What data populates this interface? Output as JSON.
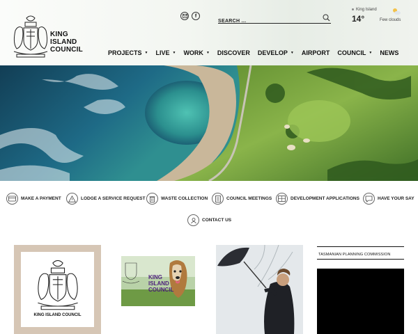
{
  "site": {
    "brand_lines": [
      "KING",
      "ISLAND",
      "COUNCIL"
    ]
  },
  "header": {
    "social": [
      {
        "icon": "email-icon"
      },
      {
        "icon": "facebook-icon",
        "glyph": "f"
      }
    ],
    "search": {
      "placeholder": "SEARCH ..."
    },
    "weather": {
      "location": "King Island",
      "temperature": "14°",
      "description": "Few clouds",
      "icon": "few-clouds-icon"
    }
  },
  "nav": {
    "items": [
      {
        "label": "PROJECTS",
        "dropdown": true
      },
      {
        "label": "LIVE",
        "dropdown": true
      },
      {
        "label": "WORK",
        "dropdown": true
      },
      {
        "label": "DISCOVER",
        "dropdown": false
      },
      {
        "label": "DEVELOP",
        "dropdown": true
      },
      {
        "label": "AIRPORT",
        "dropdown": false
      },
      {
        "label": "COUNCIL",
        "dropdown": true
      },
      {
        "label": "NEWS",
        "dropdown": false
      }
    ]
  },
  "quick_links": [
    {
      "label": "MAKE A PAYMENT",
      "icon": "payment-icon"
    },
    {
      "label": "LODGE A SERVICE REQUEST",
      "icon": "warning-icon"
    },
    {
      "label": "WASTE COLLECTION",
      "icon": "bin-icon"
    },
    {
      "label": "COUNCIL MEETINGS",
      "icon": "document-icon"
    },
    {
      "label": "DEVELOPMENT APPLICATIONS",
      "icon": "plans-icon"
    },
    {
      "label": "HAVE YOUR SAY",
      "icon": "speech-bubble-icon"
    },
    {
      "label": "CONTACT US",
      "icon": "contact-icon"
    }
  ],
  "cards": [
    {
      "caption": "KING ISLAND COUNCIL"
    },
    {
      "brand_lines": [
        "KING",
        "ISLAND",
        "COUNCIL"
      ]
    },
    {},
    {
      "heading": "TASMANIAN PLANNING COMMISSION"
    }
  ],
  "colors": {
    "card1_frame": "#d6c6b5",
    "ocean": "#1f5f7a",
    "grass": "#6f9a3c"
  }
}
